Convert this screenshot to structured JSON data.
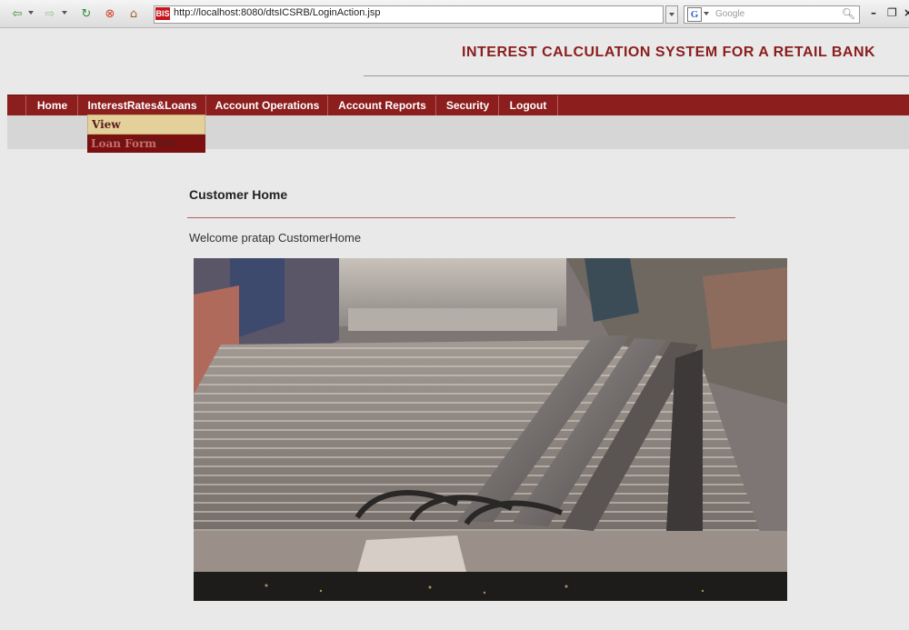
{
  "browser": {
    "url": "http://localhost:8080/dtsICSRB/LoginAction.jsp",
    "search_placeholder": "Google",
    "site_icon_label": "BIS",
    "search_engine_letter": "G"
  },
  "header": {
    "title": "INTEREST CALCULATION SYSTEM FOR A RETAIL BANK"
  },
  "nav": {
    "items": [
      {
        "label": "Home"
      },
      {
        "label": "InterestRates&Loans"
      },
      {
        "label": "Account Operations"
      },
      {
        "label": "Account Reports"
      },
      {
        "label": "Security"
      },
      {
        "label": "Logout"
      }
    ]
  },
  "dropdown": {
    "items": [
      {
        "label": "View InterestRates"
      },
      {
        "label": "Loan Form"
      }
    ]
  },
  "content": {
    "heading": "Customer Home",
    "welcome": "Welcome pratap CustomerHome"
  },
  "colors": {
    "nav_bg": "#8c1e1e",
    "title": "#8b1d1d",
    "dropdown_hover": "#e4d09a"
  }
}
